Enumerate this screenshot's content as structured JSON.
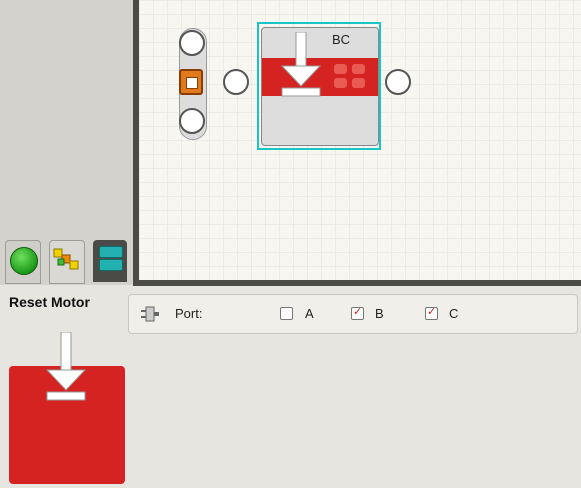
{
  "canvas": {
    "block": {
      "ports_label": "BC"
    }
  },
  "palette_tabs": [
    "common-palette",
    "complete-palette",
    "custom-palette"
  ],
  "config": {
    "block_name": "Reset Motor",
    "port_label": "Port:",
    "ports": [
      {
        "label": "A",
        "checked": false
      },
      {
        "label": "B",
        "checked": true
      },
      {
        "label": "C",
        "checked": true
      }
    ]
  },
  "colors": {
    "block_red": "#d42320",
    "selection_cyan": "#18c6c6",
    "start_orange": "#e07a1c"
  },
  "icons": {
    "reset_arrow": "down-arrow-icon",
    "motor_plug": "plug-icon"
  }
}
